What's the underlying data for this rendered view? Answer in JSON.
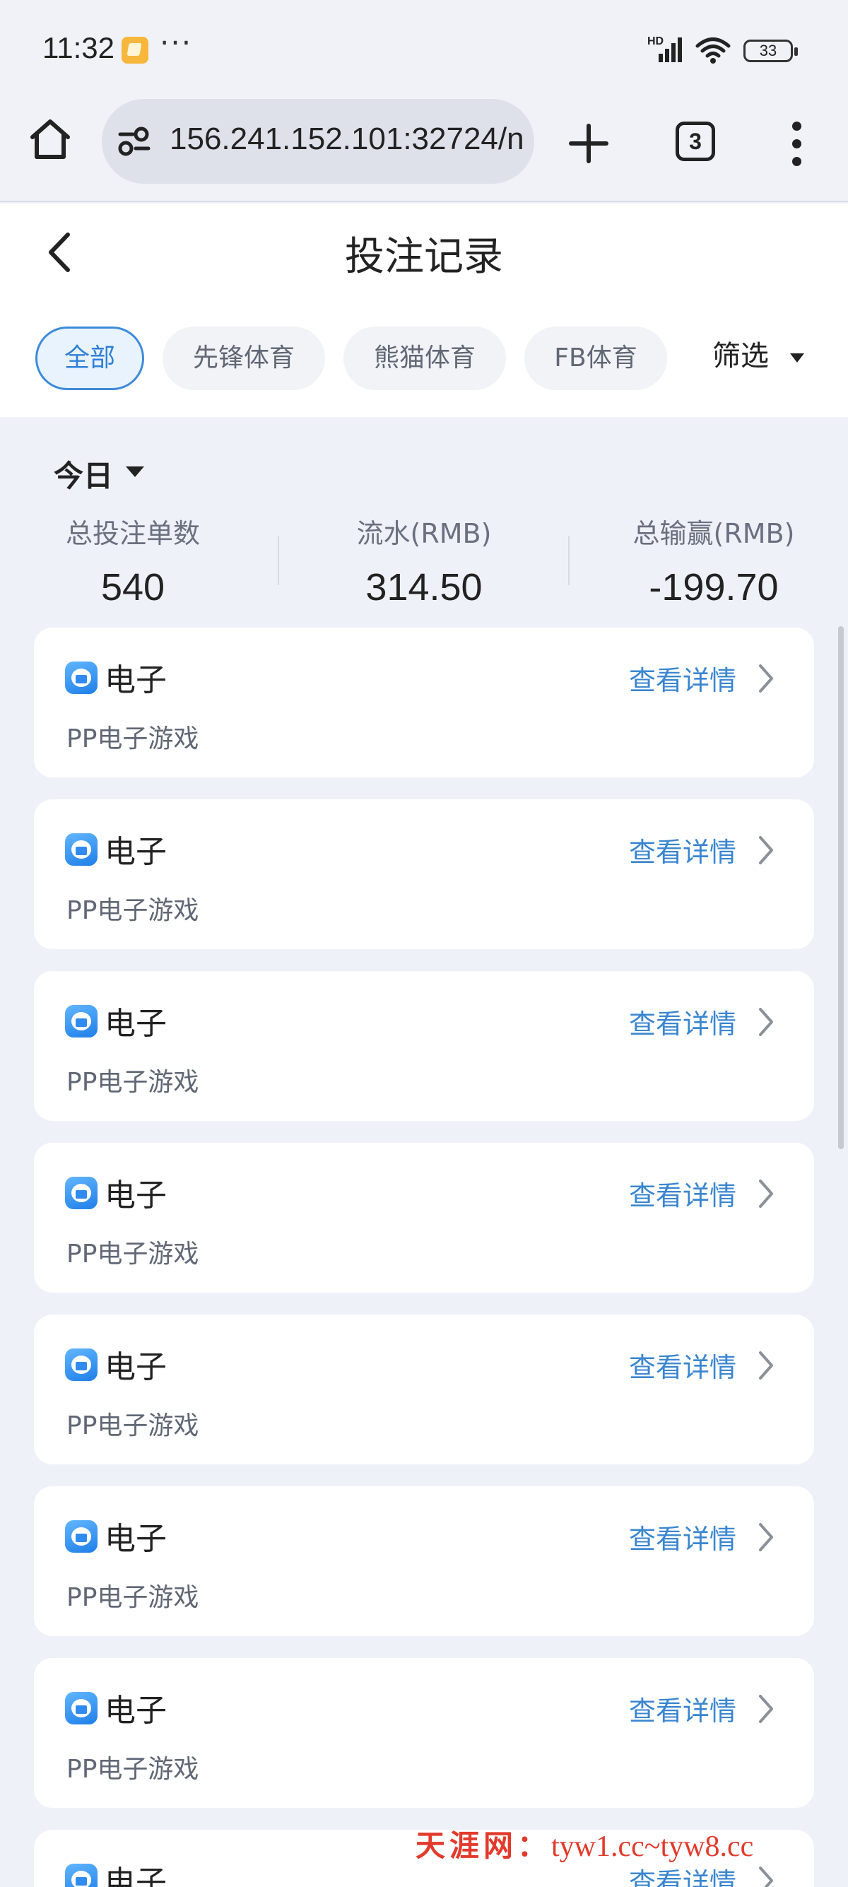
{
  "status_bar": {
    "time": "11:32",
    "dots": "···",
    "network_label": "HD",
    "battery": "33"
  },
  "browser": {
    "url": "156.241.152.101:32724/n",
    "tab_count": "3"
  },
  "header": {
    "title": "投注记录"
  },
  "tabs": [
    {
      "label": "全部",
      "active": true
    },
    {
      "label": "先锋体育",
      "active": false
    },
    {
      "label": "熊猫体育",
      "active": false
    },
    {
      "label": "FB体育",
      "active": false
    }
  ],
  "filter_label": "筛选",
  "summary": {
    "period": "今日",
    "stats": [
      {
        "label": "总投注单数",
        "value": "540"
      },
      {
        "label": "流水(RMB)",
        "value": "314.50"
      },
      {
        "label": "总输赢(RMB)",
        "value": "-199.70"
      }
    ]
  },
  "records": [
    {
      "category": "电子",
      "game": "PP电子游戏",
      "link": "查看详情"
    },
    {
      "category": "电子",
      "game": "PP电子游戏",
      "link": "查看详情"
    },
    {
      "category": "电子",
      "game": "PP电子游戏",
      "link": "查看详情"
    },
    {
      "category": "电子",
      "game": "PP电子游戏",
      "link": "查看详情"
    },
    {
      "category": "电子",
      "game": "PP电子游戏",
      "link": "查看详情"
    },
    {
      "category": "电子",
      "game": "PP电子游戏",
      "link": "查看详情"
    },
    {
      "category": "电子",
      "game": "PP电子游戏",
      "link": "查看详情"
    },
    {
      "category": "电子",
      "game": "",
      "link": "查看详情"
    }
  ],
  "watermark": {
    "brand": "天涯网：",
    "domains": "tyw1.cc~tyw8.cc"
  },
  "colors": {
    "accent": "#3a86d0",
    "page_bg": "#eff1f8",
    "watermark": "#e23a2c"
  }
}
